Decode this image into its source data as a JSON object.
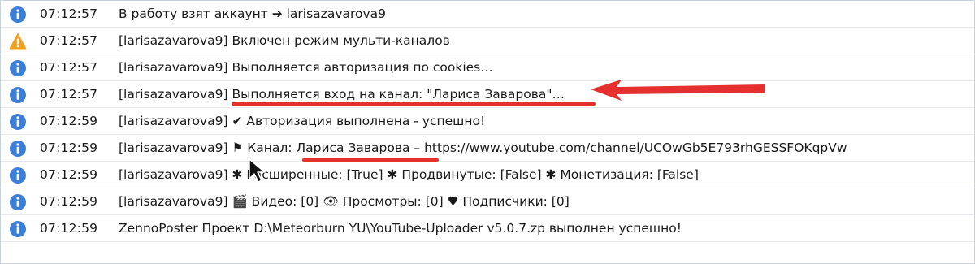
{
  "log_rows": [
    {
      "type": "info",
      "time": "07:12:57",
      "prefix": "",
      "text": "В работу взят аккаунт ➔ larisazavarova9"
    },
    {
      "type": "warning",
      "time": "07:12:57",
      "prefix": "[larisazavarova9]",
      "text": "Включен режим мульти-каналов"
    },
    {
      "type": "info",
      "time": "07:12:57",
      "prefix": "[larisazavarova9]",
      "text": "Выполняется авторизация по cookies…"
    },
    {
      "type": "info",
      "time": "07:12:57",
      "prefix": "[larisazavarova9]",
      "text": "Выполняется вход на канал: \"Лариса Заварова\"…"
    },
    {
      "type": "info",
      "time": "07:12:59",
      "prefix": "[larisazavarova9]",
      "text": "✔ Авторизация выполнена - успешно!"
    },
    {
      "type": "info",
      "time": "07:12:59",
      "prefix": "[larisazavarova9]",
      "text": "⚑ Канал: Лариса Заварова – https://www.youtube.com/channel/UCOwGb5E793rhGESSFOKqpVw"
    },
    {
      "type": "info",
      "time": "07:12:59",
      "prefix": "[larisazavarova9]",
      "text": "✱ Расширенные: [True] ✱ Продвинутые: [False] ✱ Монетизация: [False]"
    },
    {
      "type": "info",
      "time": "07:12:59",
      "prefix": "[larisazavarova9]",
      "text": "🎬 Видео: [0] 👁 Просмотры: [0] ♥ Подписчики: [0]"
    },
    {
      "type": "info",
      "time": "07:12:59",
      "prefix": "",
      "text": "ZennoPoster Проект D:\\Meteorburn YU\\YouTube-Uploader v5.0.7.zp выполнен успешно!"
    }
  ],
  "colors": {
    "info_icon": "#3d7ed6",
    "warning_icon": "#f0a020",
    "annotation": "#e53030"
  },
  "annotations": {
    "arrow": "red-arrow-pointing-left",
    "underlines": [
      "channel-entry-line",
      "channel-name"
    ]
  }
}
